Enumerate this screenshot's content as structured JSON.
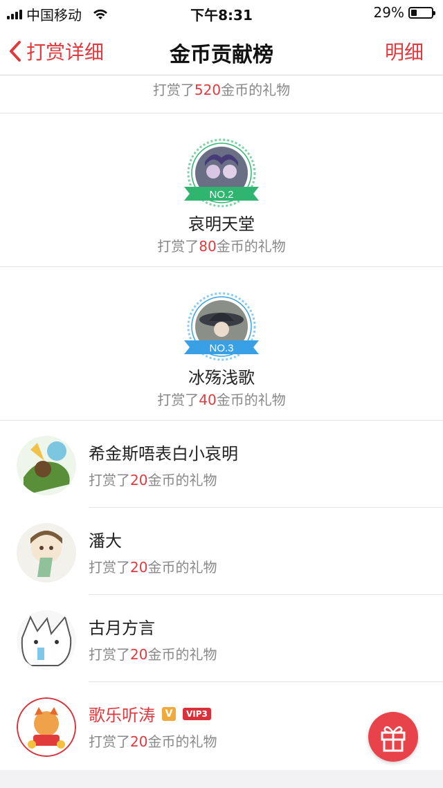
{
  "status": {
    "carrier": "中国移动",
    "time": "下午8:31",
    "battery": "29%",
    "battery_level": 0.29
  },
  "nav": {
    "back_label": "打赏详细",
    "title": "金币贡献榜",
    "right_label": "明细"
  },
  "top_partial": {
    "prefix": "打赏了",
    "amount": "520",
    "suffix": "金币的礼物"
  },
  "ranks": [
    {
      "badge": "NO.2",
      "badge_color": "#2fb56f",
      "ring_color": "#7fd0a4",
      "name": "哀明天堂",
      "prefix": "打赏了",
      "amount": "80",
      "suffix": "金币的礼物"
    },
    {
      "badge": "NO.3",
      "badge_color": "#3aa0e6",
      "ring_color": "#8ccbf2",
      "name": "冰殇浅歌",
      "prefix": "打赏了",
      "amount": "40",
      "suffix": "金币的礼物"
    }
  ],
  "list": [
    {
      "name": "希金斯唔表白小哀明",
      "prefix": "打赏了",
      "amount": "20",
      "suffix": "金币的礼物"
    },
    {
      "name": "潘大",
      "prefix": "打赏了",
      "amount": "20",
      "suffix": "金币的礼物"
    },
    {
      "name": "古月方言",
      "prefix": "打赏了",
      "amount": "20",
      "suffix": "金币的礼物"
    },
    {
      "name": "歌乐听涛",
      "prefix": "打赏了",
      "amount": "20",
      "suffix": "金币的礼物",
      "vip_badge": "V",
      "vip_level": "VIP3",
      "name_color": "#e0393e"
    }
  ],
  "colors": {
    "accent": "#e0393e",
    "fab": "#e8424a"
  },
  "icons": {
    "back": "chevron-left-icon",
    "fab": "gift-icon"
  }
}
